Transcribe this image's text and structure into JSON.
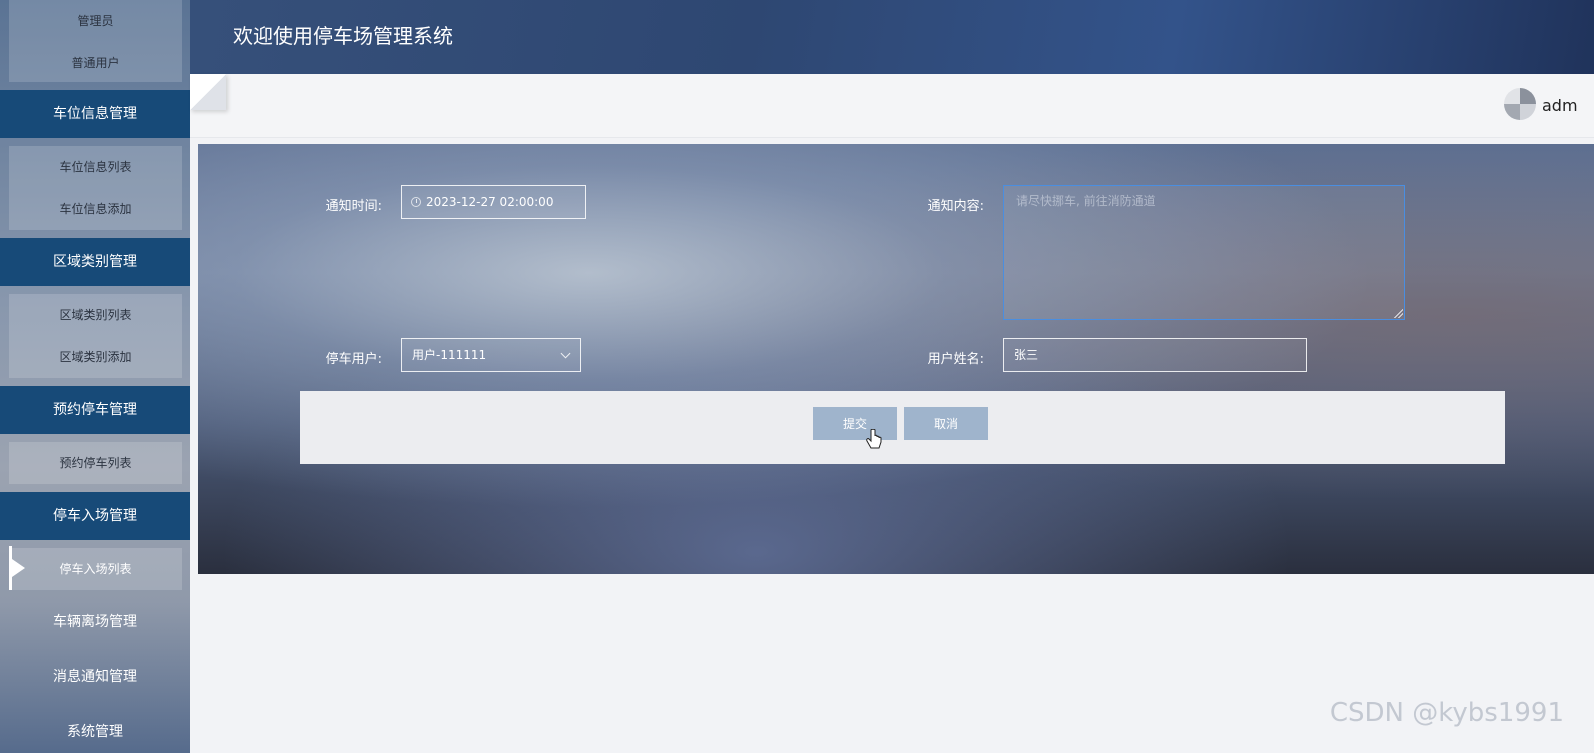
{
  "sidebar": {
    "top_sub_items": [
      "管理员",
      "普通用户"
    ],
    "sections": [
      {
        "title": "车位信息管理",
        "items": [
          "车位信息列表",
          "车位信息添加"
        ]
      },
      {
        "title": "区域类别管理",
        "items": [
          "区域类别列表",
          "区域类别添加"
        ]
      },
      {
        "title": "预约停车管理",
        "items": [
          "预约停车列表"
        ]
      },
      {
        "title": "停车入场管理",
        "items": [
          "停车入场列表"
        ]
      },
      {
        "title": "车辆离场管理",
        "items": []
      },
      {
        "title": "消息通知管理",
        "items": []
      },
      {
        "title": "系统管理",
        "items": []
      }
    ],
    "active_item": "停车入场列表"
  },
  "header": {
    "title": "欢迎使用停车场管理系统"
  },
  "topbar": {
    "username": "adm"
  },
  "form": {
    "notify_time_label": "通知时间:",
    "notify_time_value": "2023-12-27 02:00:00",
    "notify_content_label": "通知内容:",
    "notify_content_placeholder": "请尽快挪车, 前往消防通道",
    "parking_user_label": "停车用户:",
    "parking_user_value": "用户-111111",
    "user_name_label": "用户姓名:",
    "user_name_value": "张三",
    "submit_label": "提交",
    "cancel_label": "取消"
  },
  "watermark": "CSDN @kybs1991",
  "colors": {
    "sidebar_head_active": "#174a78",
    "header_bg": "#2e4772",
    "button_bg": "#9fb4cc",
    "textarea_focus_border": "#4a8ee0"
  }
}
